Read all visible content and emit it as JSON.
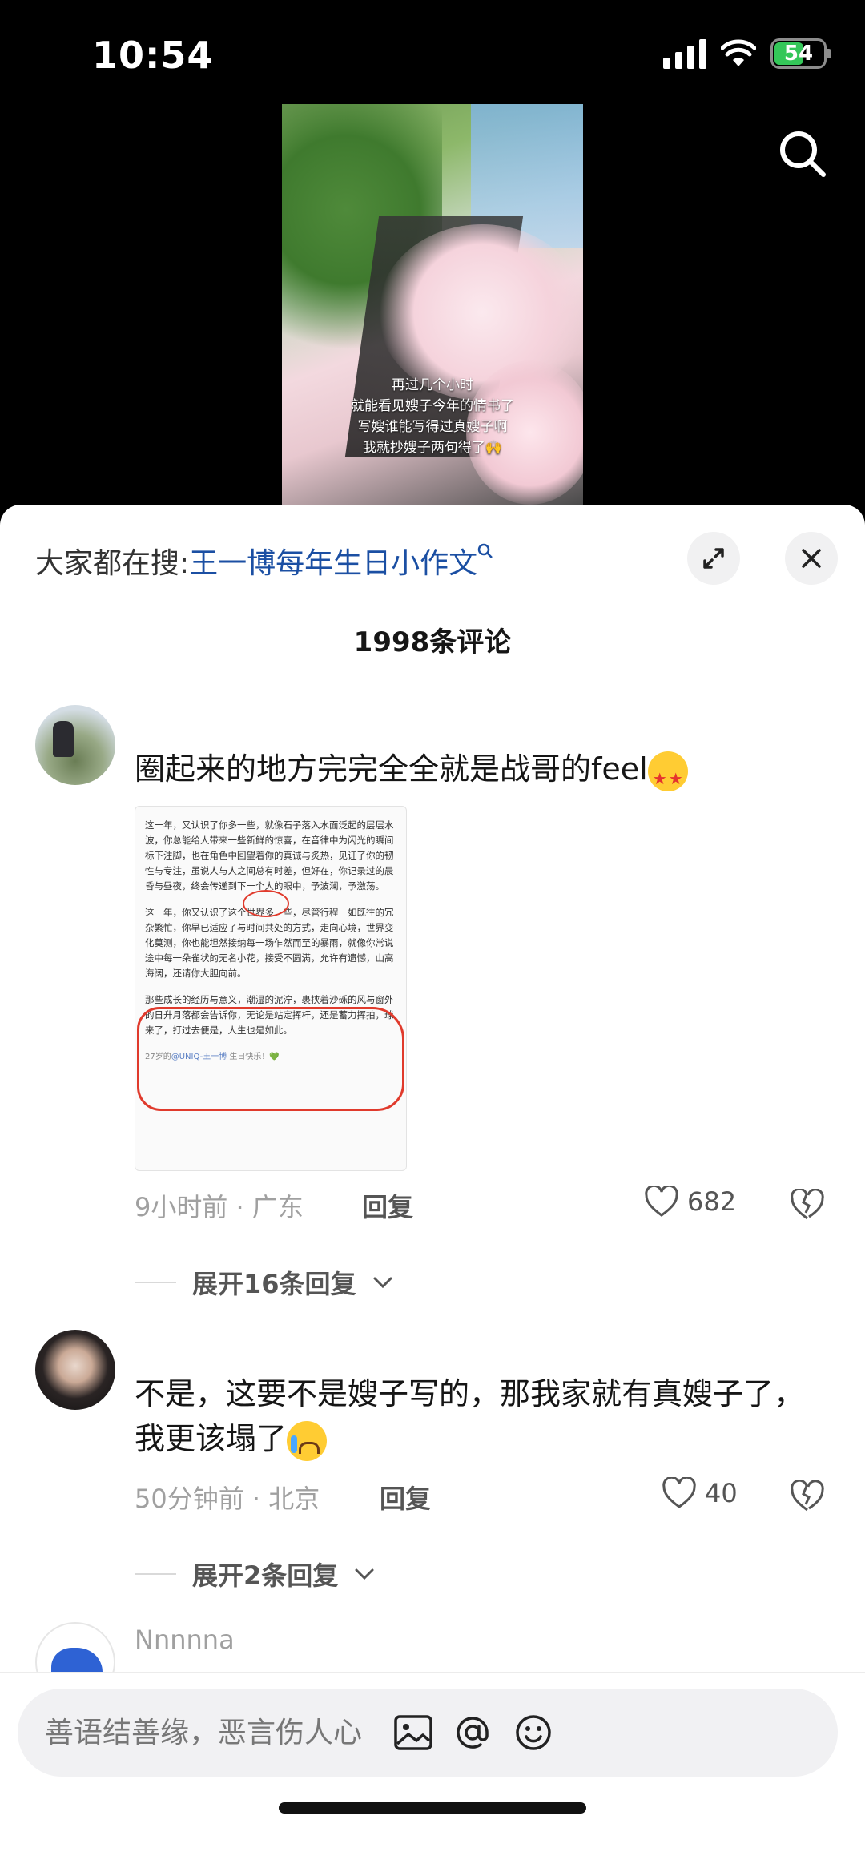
{
  "status": {
    "time": "10:54",
    "battery": "54"
  },
  "video": {
    "caption": [
      "再过几个小时",
      "就能看见嫂子今年的情书了",
      "写嫂谁能写得过真嫂子啊",
      "我就抄嫂子两句得了🙌"
    ]
  },
  "sheet": {
    "search_prefix": "大家都在搜:",
    "search_link": "王一博每年生日小作文",
    "comment_count": "1998条评论"
  },
  "comments": [
    {
      "text": "圈起来的地方完完全全就是战哥的feel",
      "image_paragraphs": [
        "这一年，又认识了你多一些，就像石子落入水面泛起的层层水波，你总能给人带来一些新鲜的惊喜，在音律中为闪光的瞬间标下注脚，也在角色中回望着你的真诚与炙热，见证了你的韧性与专注，虽说人与人之间总有时差，但好在，你记录过的晨昏与昼夜，终会传递到下一个人的眼中，予波澜，予激荡。",
        "这一年，你又认识了这个世界多一些，尽管行程一如既往的冗杂繁忙，你早已适应了与时间共处的方式，走向心境，世界变化莫测，你也能坦然接纳每一场乍然而至的暴雨，就像你常说途中每一朵雀状的无名小花，接受不圆满，允许有遗憾，山高海阔，还请你大胆向前。",
        "那些成长的经历与意义，潮湿的泥泞，裹挟着沙砾的风与窗外的日升月落都会告诉你，无论是站定挥杆，还是蓄力挥拍，球来了，打过去便是，人生也是如此。"
      ],
      "image_footer_prefix": "27岁的",
      "image_footer_link": "@UNIQ-王一博",
      "image_footer_suffix": " 生日快乐！💚",
      "meta": "9小时前 · 广东",
      "reply": "回复",
      "likes": "682",
      "expand": "展开16条回复"
    },
    {
      "text": "不是，这要不是嫂子写的，那我家就有真嫂子了，我更该塌了",
      "meta": "50分钟前 · 北京",
      "reply": "回复",
      "likes": "40",
      "expand": "展开2条回复"
    },
    {
      "name": "Nnnnna"
    }
  ],
  "input": {
    "placeholder": "善语结善缘，恶言伤人心"
  }
}
